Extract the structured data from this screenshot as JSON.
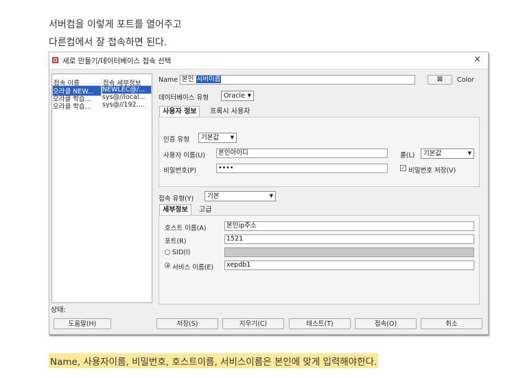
{
  "article": {
    "line1": "서버컴을 이렇게 포트를 열어주고",
    "line2": "다른컴에서 잘 접속하면 된다.",
    "caption": "Name, 사용자이름, 비밀번호, 호스트이름, 서비스이름은 본인에 맞게 입력해야한다."
  },
  "dialog": {
    "title": "새로 만들기/데이터베이스 접속 선택",
    "close_icon": "×",
    "connection_list": {
      "col_name": "접속 이름",
      "col_detail": "접속 세부정보",
      "rows": [
        {
          "name": "오라클 NEW...",
          "detail": "NEWLEC@/...",
          "selected": true
        },
        {
          "name": "오라클 학습...",
          "detail": "sys@//local...",
          "selected": false
        },
        {
          "name": "오라클 학습...",
          "detail": "sys@//192....",
          "selected": false
        }
      ]
    },
    "status_label": "상태:",
    "form": {
      "name_label": "Name",
      "name_value_plain": "본인",
      "name_value_selected": "서버이름",
      "color_label": "Color",
      "color_icon": "⊠",
      "dbtype_label": "데이터베이스 유형",
      "dbtype_value": "Oracle",
      "tabs": [
        "사용자 정보",
        "프록시 사용자"
      ],
      "auth_type_label": "인증 유형",
      "auth_type_value": "기본값",
      "username_label": "사용자 이름(U)",
      "username_value": "본인아이디",
      "role_label": "롤(L)",
      "role_value": "기본값",
      "password_label": "비밀번호(P)",
      "password_value": "••••",
      "save_password_label": "비밀번호 저장(V)",
      "save_password_checked": true,
      "conn_type_label": "접속 유형(Y)",
      "conn_type_value": "기본",
      "detail_tabs": [
        "세부정보",
        "고급"
      ],
      "host_label": "호스트 이름(A)",
      "host_value": "본인ip주소",
      "port_label": "포트(R)",
      "port_value": "1521",
      "sid_label": "SID(I)",
      "service_label": "서비스 이름(E)",
      "service_value": "xepdb1",
      "service_selected": true
    },
    "buttons": {
      "help": "도움말(H)",
      "save": "저장(S)",
      "clear": "지우기(C)",
      "test": "테스트(T)",
      "connect": "접속(O)",
      "cancel": "취소"
    },
    "colors": {
      "selection": "#2a5ec0",
      "caption_highlight": "#fbe99a",
      "sid_disabled": "#c8c8c8"
    }
  }
}
